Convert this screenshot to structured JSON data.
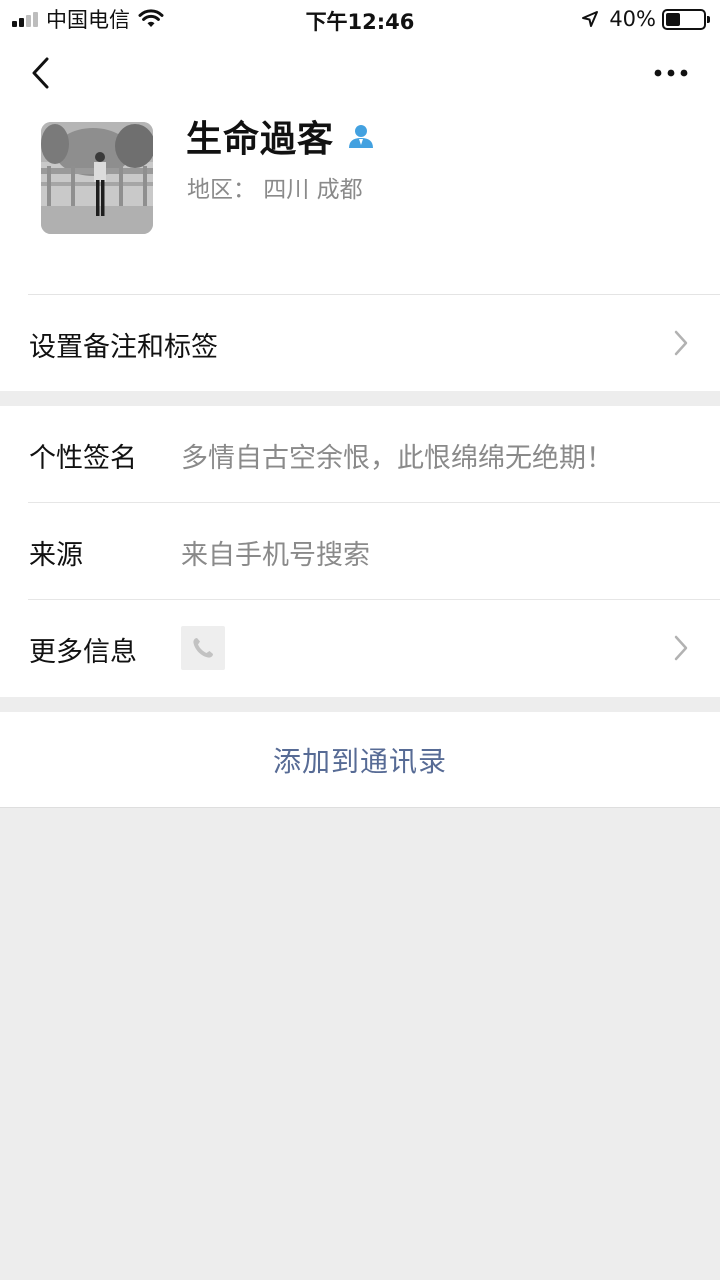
{
  "status_bar": {
    "carrier": "中国电信",
    "time": "下午12:46",
    "battery_percent": "40%",
    "battery_level": 0.4,
    "signal_bars": 2,
    "icons": [
      "signal-icon",
      "wifi-icon",
      "location-arrow-icon",
      "battery-icon"
    ]
  },
  "nav": {
    "back_icon": "chevron-left-icon",
    "more_icon": "ellipsis-icon"
  },
  "profile": {
    "name": "生命過客",
    "region": "地区： 四川 成都",
    "badge_icon": "person-icon",
    "badge_color": "#43a1e0"
  },
  "menu": {
    "remark": "设置备注和标签",
    "signature_label": "个性签名",
    "signature_value": "多情自古空余恨，此恨绵绵无绝期！",
    "source_label": "来源",
    "source_value": "来自手机号搜索",
    "more_label": "更多信息",
    "more_icon": "phone-icon"
  },
  "actions": {
    "add_contact": "添加到通讯录",
    "link_color": "#576b95"
  }
}
